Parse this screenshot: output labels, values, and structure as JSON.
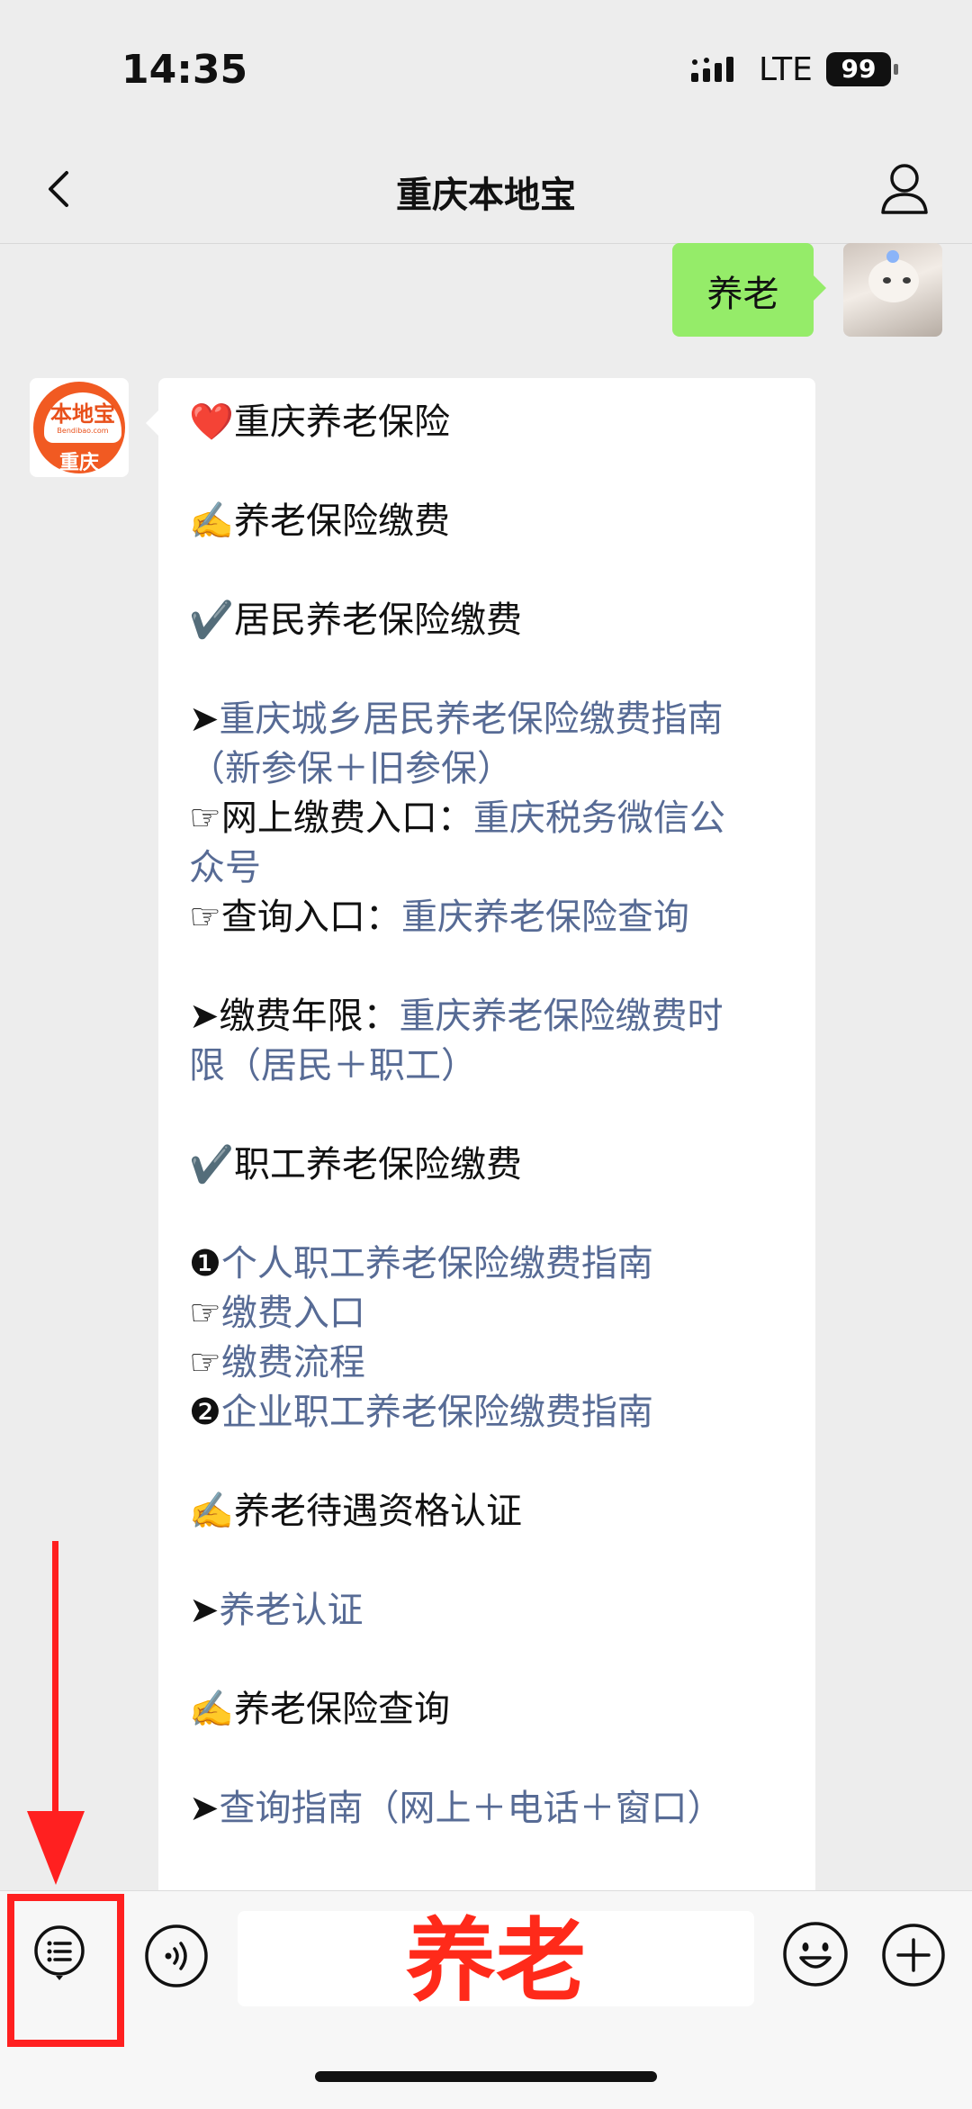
{
  "status_bar": {
    "time": "14:35",
    "network": "LTE",
    "battery": "99"
  },
  "nav": {
    "title": "重庆本地宝"
  },
  "outgoing": {
    "text": "养老"
  },
  "bot_avatar": {
    "brand": "本地宝",
    "domain": "Bendibao.com",
    "city": "重庆"
  },
  "message": {
    "lines": [
      {
        "prefix": "❤️",
        "text": "重庆养老保险",
        "link": ""
      },
      {
        "prefix": "✍️",
        "text": "养老保险缴费",
        "link": ""
      },
      {
        "prefix": "✔️",
        "text": "居民养老保险缴费",
        "link": ""
      },
      {
        "prefix": "➤",
        "text": "",
        "link": "重庆城乡居民养老保险缴费指南"
      },
      {
        "prefix": "",
        "text": "",
        "link": "（新参保＋旧参保）"
      },
      {
        "prefix": "☞",
        "text": "网上缴费入口：",
        "link": "重庆税务微信公"
      },
      {
        "prefix": "",
        "text": "",
        "link": "众号"
      },
      {
        "prefix": "☞",
        "text": "查询入口：",
        "link": "重庆养老保险查询"
      },
      {
        "prefix": "➤",
        "text": "缴费年限：",
        "link": "重庆养老保险缴费时"
      },
      {
        "prefix": "",
        "text": "",
        "link": "限（居民＋职工）"
      },
      {
        "prefix": "✔️",
        "text": "职工养老保险缴费",
        "link": ""
      },
      {
        "prefix": "❶",
        "text": "",
        "link": "个人职工养老保险缴费指南"
      },
      {
        "prefix": "☞",
        "text": "",
        "link": "缴费入口"
      },
      {
        "prefix": "☞",
        "text": "",
        "link": "缴费流程"
      },
      {
        "prefix": "❷",
        "text": "",
        "link": "企业职工养老保险缴费指南"
      },
      {
        "prefix": "✍️",
        "text": "养老待遇资格认证",
        "link": ""
      },
      {
        "prefix": "➤",
        "text": "",
        "link": "养老认证"
      },
      {
        "prefix": "✍️",
        "text": "养老保险查询",
        "link": ""
      },
      {
        "prefix": "➤",
        "text": "",
        "link": "查询指南（网上＋电话＋窗口）"
      }
    ]
  },
  "composer": {
    "input_text": "养老"
  },
  "colors": {
    "link": "#576b95",
    "bubble_out": "#95ec69",
    "annotation": "#ff2020"
  },
  "icons": {
    "back": "chevron-left-icon",
    "profile": "person-icon",
    "menu": "list-menu-icon",
    "voice": "voice-icon",
    "emoji": "smiley-icon",
    "plus": "plus-icon"
  }
}
